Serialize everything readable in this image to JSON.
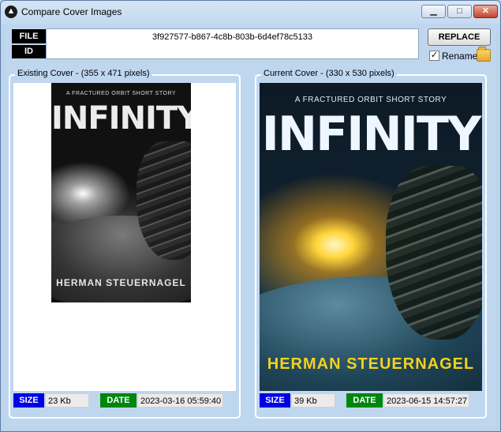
{
  "window": {
    "title": "Compare Cover Images",
    "controls": {
      "minimize": "▁",
      "maximize": "□",
      "close": "✕"
    }
  },
  "identifier": {
    "file_tag": "FILE",
    "id_tag": "ID",
    "value": "3f927577-b867-4c8b-803b-6d4ef78c5133"
  },
  "actions": {
    "replace_label": "REPLACE",
    "rename_label": "Rename",
    "rename_checked": true,
    "rename_checkmark": "✓"
  },
  "existing": {
    "legend": "Existing Cover  -  (355 x 471 pixels)",
    "cover_subtitle": "A FRACTURED ORBIT SHORT STORY",
    "cover_title": "INFINITY",
    "cover_author": "HERMAN STEUERNAGEL",
    "size_label": "SIZE",
    "size_value": "23 Kb",
    "date_label": "DATE",
    "date_value": "2023-03-16 05:59:40"
  },
  "current": {
    "legend": "Current Cover  -  (330 x 530 pixels)",
    "cover_subtitle": "A FRACTURED ORBIT SHORT STORY",
    "cover_title": "INFINITY",
    "cover_author": "HERMAN STEUERNAGEL",
    "size_label": "SIZE",
    "size_value": "39 Kb",
    "date_label": "DATE",
    "date_value": "2023-06-15 14:57:27"
  },
  "colors": {
    "size_badge": "#0000e6",
    "date_badge": "#00860c",
    "tag_background": "#000000",
    "author_current": "#f3d21c"
  },
  "icons": {
    "app": "compare-app-icon",
    "folder": "folder-icon"
  }
}
